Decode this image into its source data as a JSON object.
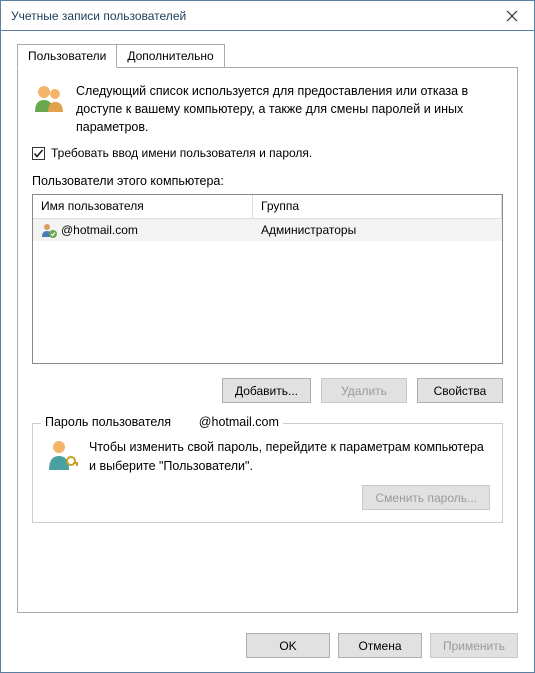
{
  "window": {
    "title": "Учетные записи пользователей"
  },
  "tabs": {
    "users": "Пользователи",
    "advanced": "Дополнительно"
  },
  "intro": {
    "text": "Следующий список используется для предоставления или отказа в доступе к вашему компьютеру, а также для смены паролей и иных параметров."
  },
  "require_login": {
    "checked": true,
    "label": "Требовать ввод имени пользователя и пароля."
  },
  "users_list": {
    "heading": "Пользователи этого компьютера:",
    "columns": {
      "user": "Имя пользователя",
      "group": "Группа"
    },
    "rows": [
      {
        "username": "@hotmail.com",
        "group": "Администраторы"
      }
    ]
  },
  "buttons": {
    "add": "Добавить...",
    "remove": "Удалить",
    "properties": "Свойства"
  },
  "password_box": {
    "title_prefix": "Пароль пользователя ",
    "title_suffix": "@hotmail.com",
    "text": "Чтобы изменить свой пароль, перейдите к параметрам компьютера и выберите \"Пользователи\".",
    "change_btn": "Сменить пароль..."
  },
  "dialog_buttons": {
    "ok": "OK",
    "cancel": "Отмена",
    "apply": "Применить"
  }
}
